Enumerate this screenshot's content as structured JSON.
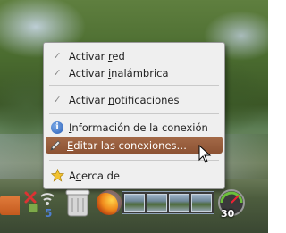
{
  "menu": {
    "items": [
      {
        "label": "Activar red",
        "mnemonic_index": 8,
        "icon": "check-icon"
      },
      {
        "label": "Activar inalámbrica",
        "mnemonic_index": 8,
        "icon": "check-icon"
      },
      {
        "label": "Activar notificaciones",
        "mnemonic_index": 8,
        "icon": "check-icon"
      },
      {
        "label": "Información de la conexión",
        "mnemonic_index": 0,
        "icon": "info-icon"
      },
      {
        "label": "Editar las conexiones…",
        "mnemonic_index": 0,
        "icon": "edit-icon",
        "selected": true
      },
      {
        "label": "Acerca de",
        "mnemonic_index": 1,
        "icon": "star-icon"
      }
    ]
  },
  "taskbar": {
    "workspace_badge": "30"
  },
  "colors": {
    "menu_background": "#efefef",
    "selection": "#95593a",
    "info_blue": "#2b5fb8"
  }
}
